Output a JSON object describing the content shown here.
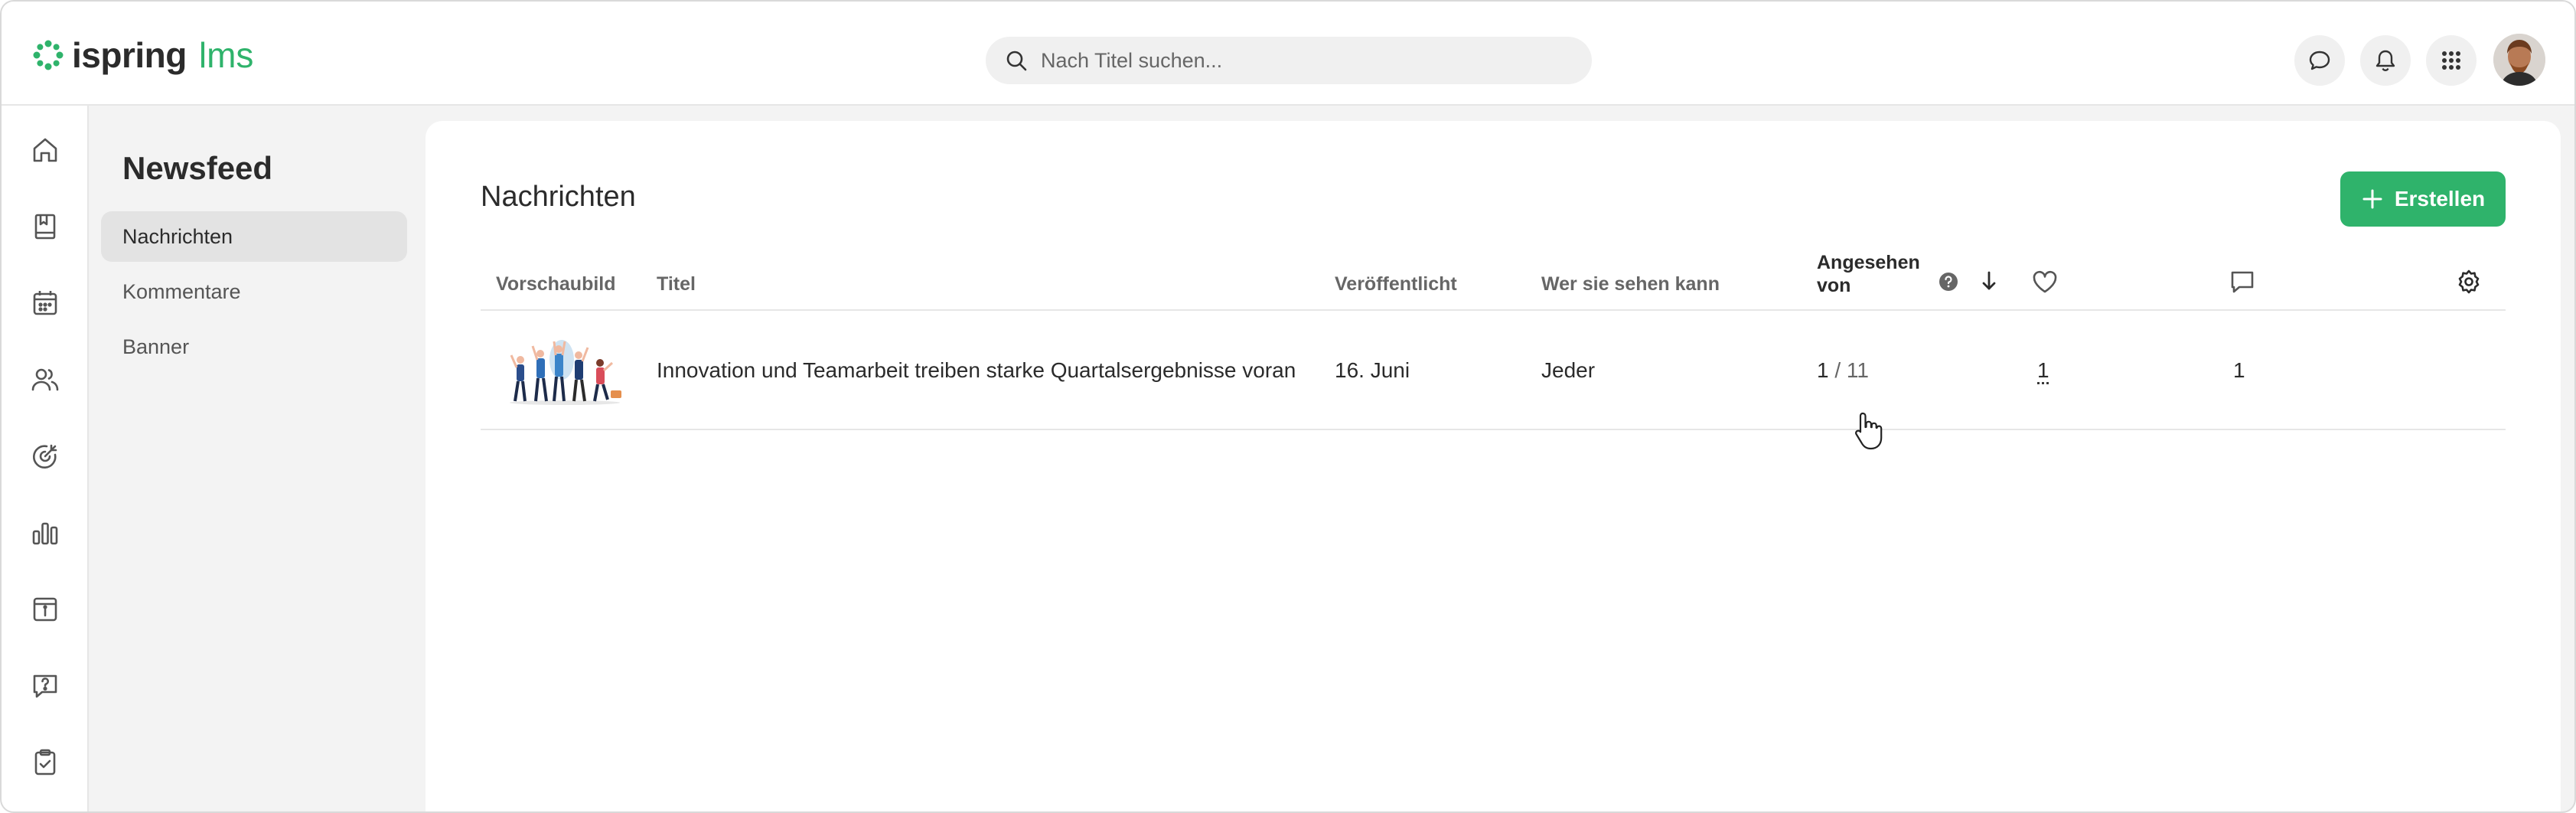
{
  "app": {
    "logo_word": "ispring",
    "logo_suffix": "lms"
  },
  "search": {
    "placeholder": "Nach Titel suchen..."
  },
  "topbar_icons": [
    "chat-icon",
    "bell-icon",
    "apps-grid-icon"
  ],
  "sidebar_icons": [
    "home-icon",
    "book-icon",
    "calendar-icon",
    "users-icon",
    "target-icon",
    "chart-icon",
    "info-archive-icon",
    "question-icon",
    "clipboard-check-icon"
  ],
  "subnav": {
    "title": "Newsfeed",
    "items": [
      {
        "label": "Nachrichten",
        "active": true
      },
      {
        "label": "Kommentare",
        "active": false
      },
      {
        "label": "Banner",
        "active": false
      }
    ]
  },
  "main": {
    "title": "Nachrichten",
    "create_label": "Erstellen",
    "columns": {
      "preview": "Vorschaubild",
      "title": "Titel",
      "published": "Veröffentlicht",
      "audience": "Wer sie sehen kann",
      "viewed_line1": "Angesehen",
      "viewed_line2": "von"
    },
    "rows": [
      {
        "title": "Innovation und Teamarbeit treiben starke Quartalsergebnisse voran",
        "published": "16. Juni",
        "audience": "Jeder",
        "viewed": "1",
        "viewed_total": "/ 11",
        "likes": "1",
        "comments": "1"
      }
    ]
  },
  "colors": {
    "accent": "#2fb36b",
    "text": "#2b2b2b",
    "muted": "#666666",
    "surface": "#f3f3f3"
  }
}
